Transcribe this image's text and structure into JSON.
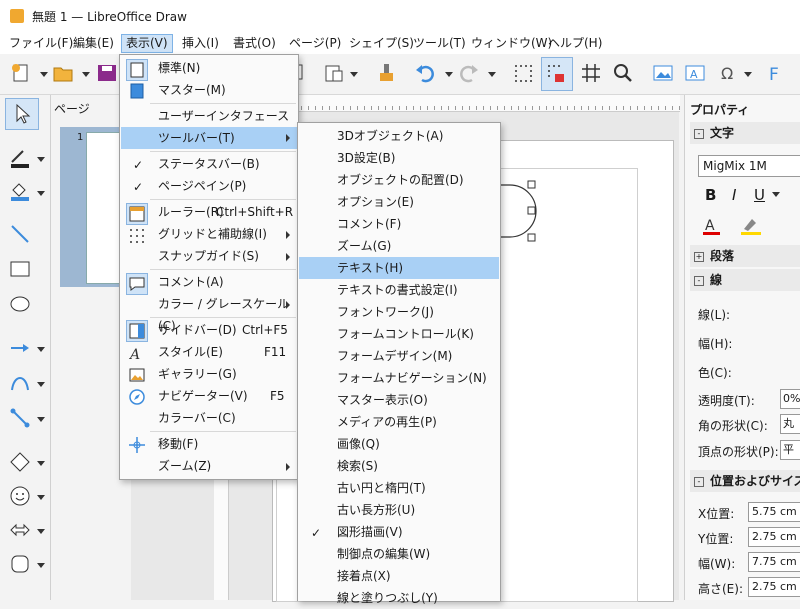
{
  "window": {
    "title": "無題 1 — LibreOffice Draw"
  },
  "menubar": [
    {
      "label": "ファイル(F)"
    },
    {
      "label": "編集(E)"
    },
    {
      "label": "表示(V)"
    },
    {
      "label": "挿入(I)"
    },
    {
      "label": "書式(O)"
    },
    {
      "label": "ページ(P)"
    },
    {
      "label": "シェイプ(S)"
    },
    {
      "label": "ツール(T)"
    },
    {
      "label": "ウィンドウ(W)"
    },
    {
      "label": "ヘルプ(H)"
    }
  ],
  "pages_panel": {
    "title": "ページ",
    "page_number": "1"
  },
  "view_menu": [
    {
      "label": "標準(N)",
      "icon": "normal-view-icon"
    },
    {
      "label": "マスター(M)",
      "icon": "master-view-icon"
    },
    {
      "label": "ユーザーインタフェース(I)..."
    },
    {
      "label": "ツールバー(T)"
    },
    {
      "label": "ステータスバー(B)"
    },
    {
      "label": "ページペイン(P)"
    },
    {
      "label": "ルーラー(R)",
      "accel": "Ctrl+Shift+R"
    },
    {
      "label": "グリッドと補助線(I)"
    },
    {
      "label": "スナップガイド(S)"
    },
    {
      "label": "コメント(A)"
    },
    {
      "label": "カラー / グレースケール(C)"
    },
    {
      "label": "サイドバー(D)",
      "accel": "Ctrl+F5"
    },
    {
      "label": "スタイル(E)",
      "accel": "F11"
    },
    {
      "label": "ギャラリー(G)"
    },
    {
      "label": "ナビゲーター(V)",
      "accel": "F5"
    },
    {
      "label": "カラーバー(C)"
    },
    {
      "label": "移動(F)"
    },
    {
      "label": "ズーム(Z)"
    }
  ],
  "toolbar_submenu": [
    {
      "label": "3Dオブジェクト(A)"
    },
    {
      "label": "3D設定(B)"
    },
    {
      "label": "オブジェクトの配置(D)"
    },
    {
      "label": "オプション(E)"
    },
    {
      "label": "コメント(F)"
    },
    {
      "label": "ズーム(G)"
    },
    {
      "label": "テキスト(H)"
    },
    {
      "label": "テキストの書式設定(I)"
    },
    {
      "label": "フォントワーク(J)"
    },
    {
      "label": "フォームコントロール(K)"
    },
    {
      "label": "フォームデザイン(M)"
    },
    {
      "label": "フォームナビゲーション(N)"
    },
    {
      "label": "マスター表示(O)"
    },
    {
      "label": "メディアの再生(P)"
    },
    {
      "label": "画像(Q)"
    },
    {
      "label": "検索(S)"
    },
    {
      "label": "古い円と楕円(T)"
    },
    {
      "label": "古い長方形(U)"
    },
    {
      "label": "図形描画(V)"
    },
    {
      "label": "制御点の編集(W)"
    },
    {
      "label": "接着点(X)"
    },
    {
      "label": "線と塗りつぶし(Y)"
    }
  ],
  "sidebar": {
    "title": "プロパティ",
    "char_section": "文字",
    "font_name": "MigMix 1M",
    "bold": "B",
    "italic": "I",
    "underline": "U",
    "paragraph_section": "段落",
    "line_section": "線",
    "line_label": "線(L):",
    "width_label": "幅(H):",
    "color_label": "色(C):",
    "transparency_label": "透明度(T):",
    "transparency_value": "0%",
    "corner_label": "角の形状(C):",
    "corner_value": "丸",
    "cap_label": "頂点の形状(P):",
    "cap_value": "平ら",
    "possize_section": "位置およびサイズ(",
    "x_label": "X位置:",
    "x_value": "5.75 cm",
    "y_label": "Y位置:",
    "y_value": "2.75 cm",
    "w_label": "幅(W):",
    "w_value": "7.75 cm",
    "h_label": "高さ(E):",
    "h_value": "2.75 cm"
  },
  "colors": {
    "accent": "#3c8bdc",
    "highlight": "#a9d0f5",
    "menu_active": "#cfe3f7"
  }
}
